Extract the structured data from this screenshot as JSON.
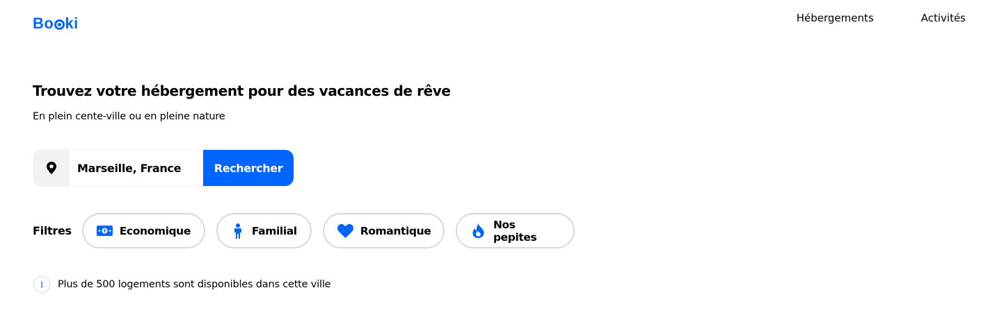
{
  "header": {
    "logo_prefix": "Bo",
    "logo_suffix": "ki",
    "nav": [
      {
        "label": "Hébergements"
      },
      {
        "label": "Activités"
      }
    ]
  },
  "hero": {
    "title": "Trouvez votre hébergement pour des vacances de rêve",
    "subtitle": "En plein cente-ville ou en pleine nature"
  },
  "search": {
    "value": "Marseille, France",
    "button_label": "Rechercher",
    "icon": "map-pin-icon"
  },
  "filters": {
    "label": "Filtres",
    "items": [
      {
        "label": "Economique",
        "icon": "money-bill-icon"
      },
      {
        "label": "Familial",
        "icon": "person-icon"
      },
      {
        "label": "Romantique",
        "icon": "heart-icon"
      },
      {
        "label": "Nos pepites",
        "icon": "fire-icon"
      }
    ]
  },
  "info": {
    "icon": "info-icon",
    "icon_glyph": "i",
    "text": "Plus de 500 logements sont disponibles dans cette ville"
  },
  "colors": {
    "brand": "#0065fc",
    "chip_border": "#d9d9d9",
    "input_icon_bg": "#f2f2f2"
  }
}
